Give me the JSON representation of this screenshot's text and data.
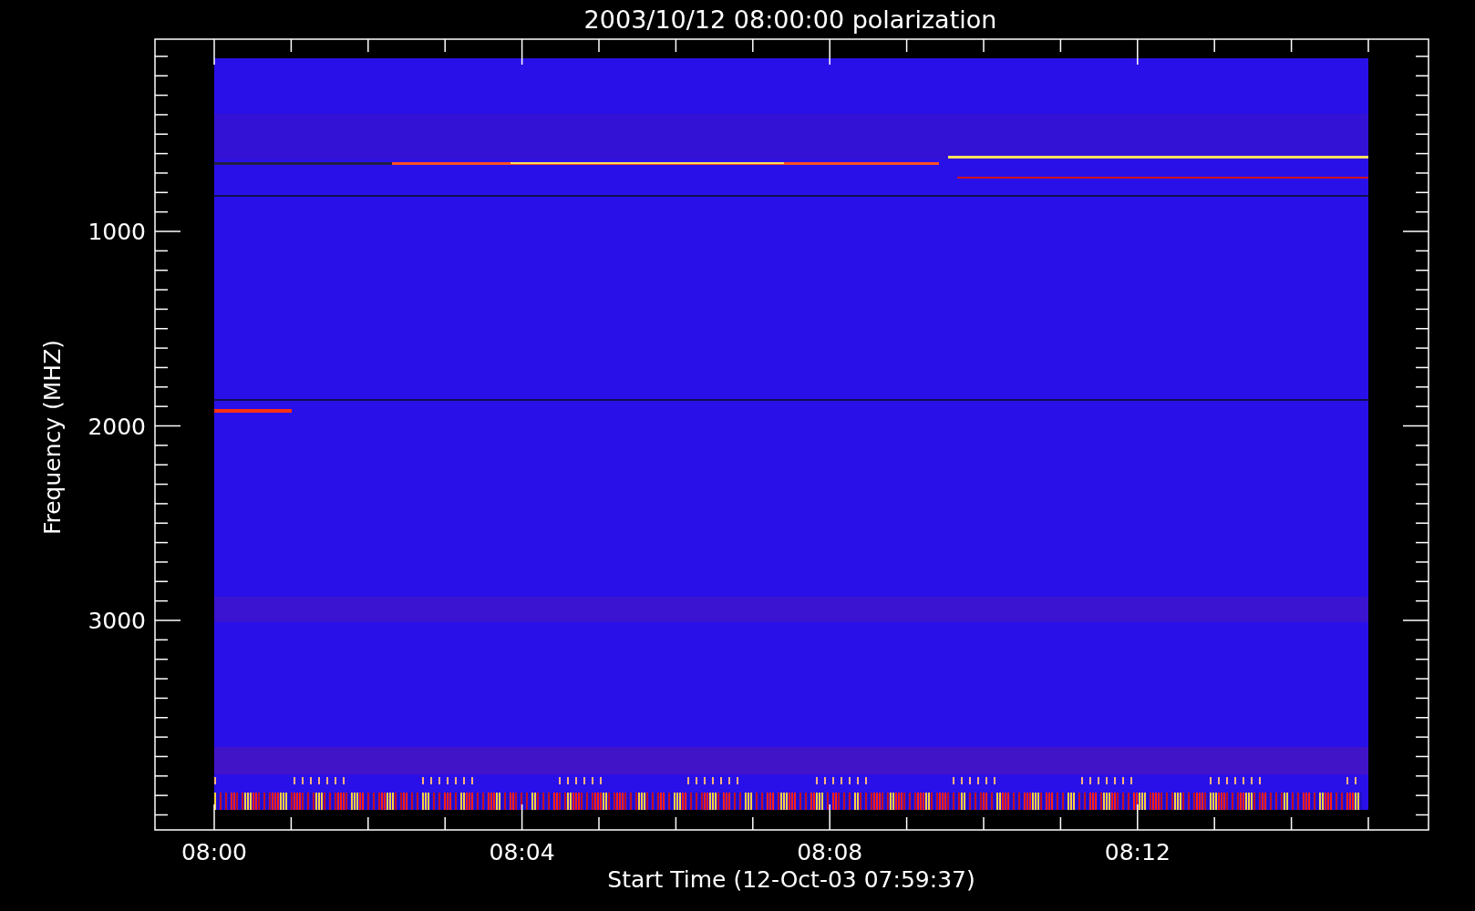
{
  "title": "2003/10/12 08:00:00 polarization",
  "y_axis": {
    "label": "Frequency (MHZ)",
    "ticks": [
      "1000",
      "2000",
      "3000"
    ]
  },
  "x_axis": {
    "label": "Start Time (12-Oct-03 07:59:37)",
    "ticks": [
      "08:00",
      "08:04",
      "08:08",
      "08:12"
    ]
  }
}
